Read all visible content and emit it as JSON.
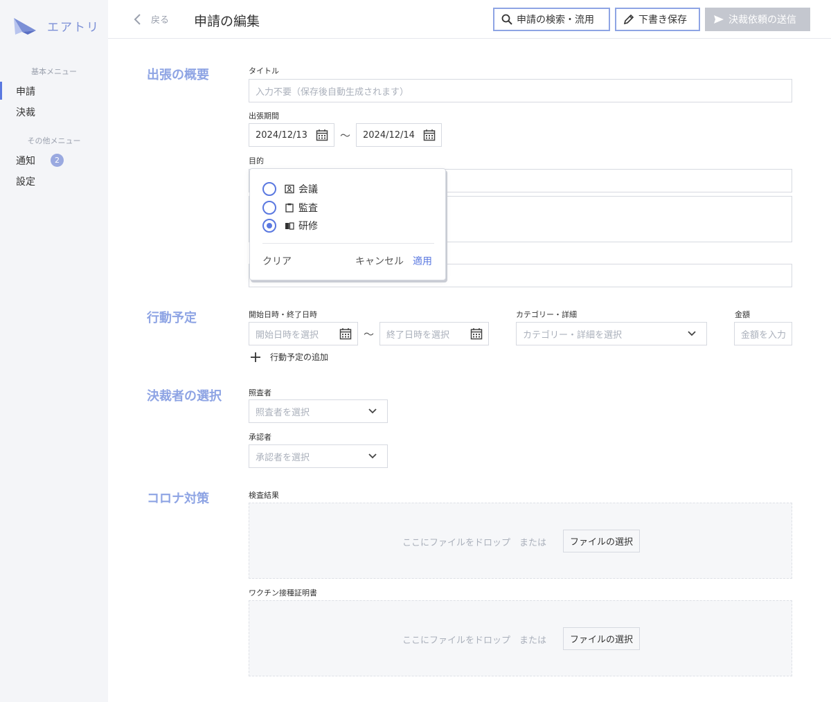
{
  "app": {
    "name": "エアトリ"
  },
  "sidebar": {
    "basic_menu_label": "基本メニュー",
    "other_menu_label": "その他メニュー",
    "items": {
      "application": "申請",
      "approval": "決裁",
      "notifications": "通知",
      "notifications_badge": "2",
      "settings": "設定"
    }
  },
  "header": {
    "back_label": "戻る",
    "title": "申請の編集",
    "search_reuse_label": "申請の検索・流用",
    "save_draft_label": "下書き保存",
    "send_label": "決裁依頼の送信"
  },
  "overview": {
    "section_title": "出張の概要",
    "title_label": "タイトル",
    "title_placeholder": "入力不要（保存後自動生成されます）",
    "period_label": "出張期間",
    "start_date": "2024/12/13",
    "end_date": "2024/12/14",
    "tilde": "〜",
    "purpose_label": "目的"
  },
  "purpose_popover": {
    "options": [
      "会議",
      "監査",
      "研修"
    ],
    "selected": "研修",
    "clear_label": "クリア",
    "cancel_label": "キャンセル",
    "apply_label": "適用"
  },
  "schedule": {
    "section_title": "行動予定",
    "datetime_label": "開始日時・終了日時",
    "start_placeholder": "開始日時を選択",
    "end_placeholder": "終了日時を選択",
    "category_label": "カテゴリー・詳細",
    "category_placeholder": "カテゴリー・詳細を選択",
    "amount_label": "金額",
    "amount_placeholder": "金額を入力",
    "add_label": "行動予定の追加"
  },
  "approvers": {
    "section_title": "決裁者の選択",
    "reviewer_label": "照査者",
    "reviewer_placeholder": "照査者を選択",
    "approver_label": "承認者",
    "approver_placeholder": "承認者を選択"
  },
  "covid": {
    "section_title": "コロナ対策",
    "test_result_label": "検査結果",
    "vaccine_label": "ワクチン接種証明書",
    "drop_text": "ここにファイルをドロップ　または",
    "select_file_label": "ファイルの選択"
  },
  "colors": {
    "accent": "#5a78e0",
    "section_title": "#8ea4e4",
    "disabled_button": "#c4c7cf"
  }
}
